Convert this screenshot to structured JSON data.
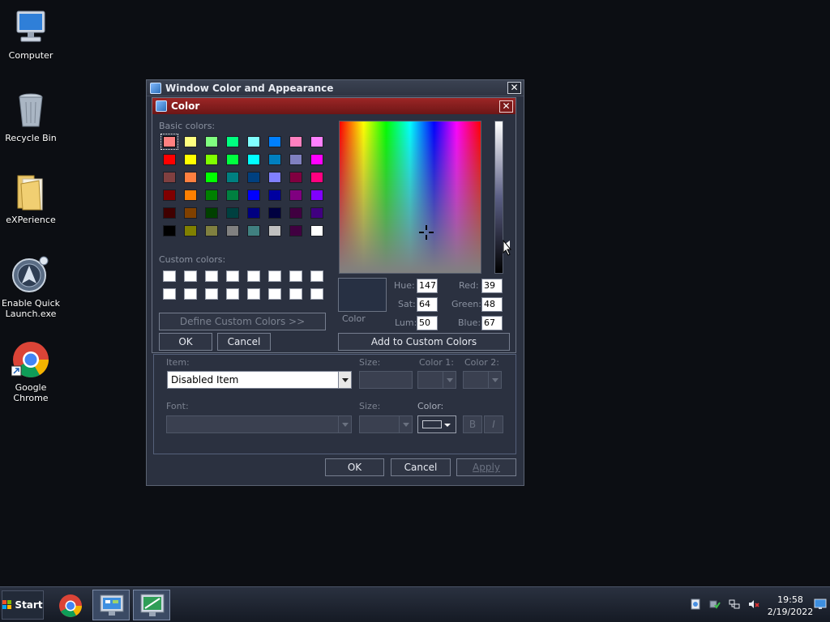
{
  "desktop": {
    "icons": [
      {
        "label": "Computer"
      },
      {
        "label": "Recycle Bin"
      },
      {
        "label": "eXPerience"
      },
      {
        "label": "Enable Quick Launch.exe"
      },
      {
        "label": "Google Chrome"
      }
    ]
  },
  "outer_window": {
    "title": "Window Color and Appearance",
    "item_label": "Item:",
    "item_value": "Disabled Item",
    "size_label": "Size:",
    "color1_label": "Color 1:",
    "color2_label": "Color 2:",
    "font_label": "Font:",
    "font_size_label": "Size:",
    "font_color_label": "Color:",
    "bold_label": "B",
    "italic_label": "I",
    "ok": "OK",
    "cancel": "Cancel",
    "apply": "Apply"
  },
  "color_dialog": {
    "title": "Color",
    "basic_colors_label": "Basic colors:",
    "custom_colors_label": "Custom colors:",
    "define_custom": "Define Custom Colors >>",
    "ok": "OK",
    "cancel": "Cancel",
    "color_label": "Color",
    "add_custom": "Add to Custom Colors",
    "hue_label": "Hue:",
    "hue": "147",
    "sat_label": "Sat:",
    "sat": "64",
    "lum_label": "Lum:",
    "lum": "50",
    "red_label": "Red:",
    "red": "39",
    "green_label": "Green:",
    "green": "48",
    "blue_label": "Blue:",
    "blue": "67",
    "basic_colors": [
      "#ff8080",
      "#ffff80",
      "#80ff80",
      "#00ff80",
      "#80ffff",
      "#0080ff",
      "#ff80c0",
      "#ff80ff",
      "#ff0000",
      "#ffff00",
      "#80ff00",
      "#00ff40",
      "#00ffff",
      "#0080c0",
      "#8080c0",
      "#ff00ff",
      "#804040",
      "#ff8040",
      "#00ff00",
      "#008080",
      "#004080",
      "#8080ff",
      "#800040",
      "#ff0080",
      "#800000",
      "#ff8000",
      "#008000",
      "#008040",
      "#0000ff",
      "#0000a0",
      "#800080",
      "#8000ff",
      "#400000",
      "#804000",
      "#004000",
      "#004040",
      "#000080",
      "#000040",
      "#400040",
      "#400080",
      "#000000",
      "#808000",
      "#808040",
      "#808080",
      "#408080",
      "#c0c0c0",
      "#400040",
      "#ffffff"
    ],
    "selected_color": "#273043"
  },
  "taskbar": {
    "start": "Start",
    "time": "19:58",
    "date": "2/19/2022"
  }
}
